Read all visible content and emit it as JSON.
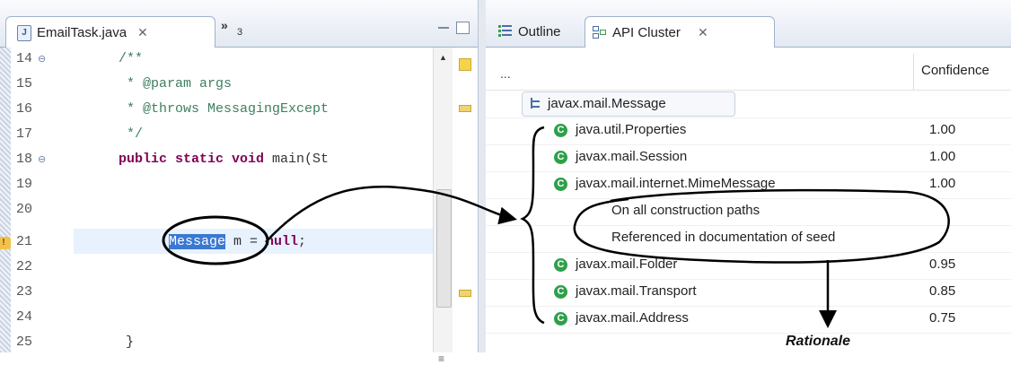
{
  "editor": {
    "tab_label": "EmailTask.java",
    "overflow_count": "3",
    "line_numbers": [
      "14",
      "15",
      "16",
      "17",
      "18",
      "19",
      "20",
      "21",
      "22",
      "23",
      "24",
      "25"
    ],
    "code": {
      "l14": "/**",
      "l15": " * @param args",
      "l16": " * @throws MessagingExcept",
      "l17": " */",
      "l18_kw": "public static void",
      "l18_rest": " main(St",
      "l21_sel": "Message",
      "l21_rest": " m = ",
      "l21_kw": "null",
      "l21_end": ";",
      "l24": "}"
    }
  },
  "view": {
    "tabs": {
      "outline": "Outline",
      "api_cluster": "API Cluster"
    },
    "columns": {
      "name": "...",
      "confidence": "Confidence"
    },
    "root": "javax.mail.Message",
    "rows": [
      {
        "label": "java.util.Properties",
        "confidence": "1.00"
      },
      {
        "label": "javax.mail.Session",
        "confidence": "1.00"
      },
      {
        "label": "javax.mail.internet.MimeMessage",
        "confidence": "1.00"
      },
      {
        "label": "On all construction paths",
        "confidence": ""
      },
      {
        "label": "Referenced in documentation of seed",
        "confidence": ""
      },
      {
        "label": "javax.mail.Folder",
        "confidence": "0.95"
      },
      {
        "label": "javax.mail.Transport",
        "confidence": "0.85"
      },
      {
        "label": "javax.mail.Address",
        "confidence": "0.75"
      }
    ]
  },
  "annotation": {
    "rationale": "Rationale"
  },
  "icons": {
    "java_file": "java-file-icon",
    "class": "class-icon",
    "hierarchy": "type-hierarchy-icon",
    "outline": "outline-icon",
    "api_cluster": "api-cluster-icon",
    "warning": "warning-marker-icon"
  },
  "colors": {
    "keyword": "#7f0055",
    "comment": "#3f7f5f",
    "selection": "#3a78d4",
    "class_icon": "#2ea04a"
  }
}
